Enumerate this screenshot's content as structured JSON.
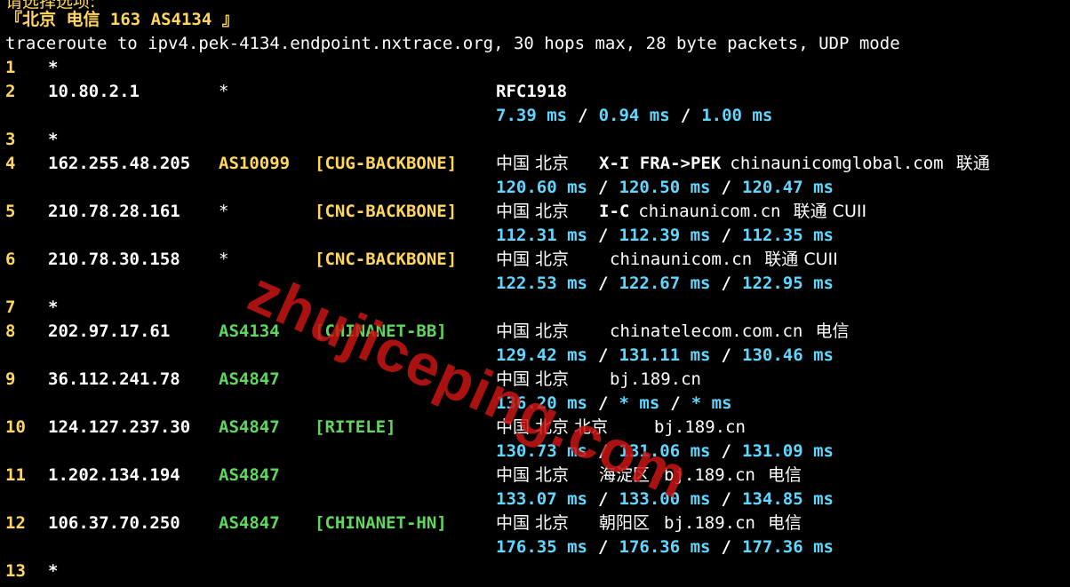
{
  "header": {
    "prompt_partial": "请选择选项:",
    "target_label": "『北京 电信 163 AS4134 』",
    "command_line": "traceroute to ipv4.pek-4134.endpoint.nxtrace.org, 30 hops max, 28 byte packets, UDP mode"
  },
  "hops": [
    {
      "num": "1",
      "star": "*"
    },
    {
      "num": "2",
      "ip": "10.80.2.1",
      "asn": "*",
      "tag": "",
      "geo": "RFC1918",
      "lat": [
        "7.39 ms",
        "0.94 ms",
        "1.00 ms"
      ]
    },
    {
      "num": "3",
      "star": "*"
    },
    {
      "num": "4",
      "ip": "162.255.48.205",
      "asn": "AS10099",
      "tag": "[CUG-BACKBONE]",
      "geo": "中国 北京",
      "extra": "X-I FRA->PEK",
      "domain": "chinaunicomglobal.com",
      "isp": "联通",
      "lat": [
        "120.60 ms",
        "120.50 ms",
        "120.47 ms"
      ]
    },
    {
      "num": "5",
      "ip": "210.78.28.161",
      "asn": "*",
      "tag": "[CNC-BACKBONE]",
      "geo": "中国 北京",
      "extra": "I-C",
      "domain": "chinaunicom.cn",
      "isp": "联通 CUII",
      "lat": [
        "112.31 ms",
        "112.39 ms",
        "112.35 ms"
      ]
    },
    {
      "num": "6",
      "ip": "210.78.30.158",
      "asn": "*",
      "tag": "[CNC-BACKBONE]",
      "geo": "中国 北京",
      "extra": "",
      "domain": "chinaunicom.cn",
      "isp": "联通 CUII",
      "lat": [
        "122.53 ms",
        "122.67 ms",
        "122.95 ms"
      ]
    },
    {
      "num": "7",
      "star": "*"
    },
    {
      "num": "8",
      "ip": "202.97.17.61",
      "asn": "AS4134",
      "tag": "[CHINANET-BB]",
      "geo": "中国 北京",
      "extra": "",
      "domain": "chinatelecom.com.cn",
      "isp": "电信",
      "lat": [
        "129.42 ms",
        "131.11 ms",
        "130.46 ms"
      ]
    },
    {
      "num": "9",
      "ip": "36.112.241.78",
      "asn": "AS4847",
      "tag": "",
      "geo": "中国 北京",
      "extra": "",
      "domain": "bj.189.cn",
      "isp": "",
      "lat": [
        "136.20 ms",
        "* ms",
        "* ms"
      ]
    },
    {
      "num": "10",
      "ip": "124.127.237.30",
      "asn": "AS4847",
      "tag": "[RITELE]",
      "geo": "中国 北京 北京",
      "extra": "",
      "domain": "bj.189.cn",
      "isp": "",
      "lat": [
        "130.73 ms",
        "131.06 ms",
        "131.09 ms"
      ]
    },
    {
      "num": "11",
      "ip": "1.202.134.194",
      "asn": "AS4847",
      "tag": "",
      "geo": "中国 北京",
      "extra": "海淀区",
      "domain": "bj.189.cn",
      "isp": "电信",
      "lat": [
        "133.07 ms",
        "133.00 ms",
        "134.85 ms"
      ]
    },
    {
      "num": "12",
      "ip": "106.37.70.250",
      "asn": "AS4847",
      "tag": "[CHINANET-HN]",
      "geo": "中国 北京",
      "extra": "朝阳区",
      "domain": "bj.189.cn",
      "isp": "电信",
      "lat": [
        "176.35 ms",
        "176.36 ms",
        "177.36 ms"
      ]
    },
    {
      "num": "13",
      "star": "*"
    }
  ],
  "separator": "/",
  "watermark": "zhujiceping.com",
  "colors": {
    "background": "#000000",
    "hop_number": "#ffd75f",
    "latency": "#5fd7ff",
    "asn_yellow": "#ffd75f",
    "asn_green": "#5fd75f",
    "watermark": "#c81414"
  }
}
